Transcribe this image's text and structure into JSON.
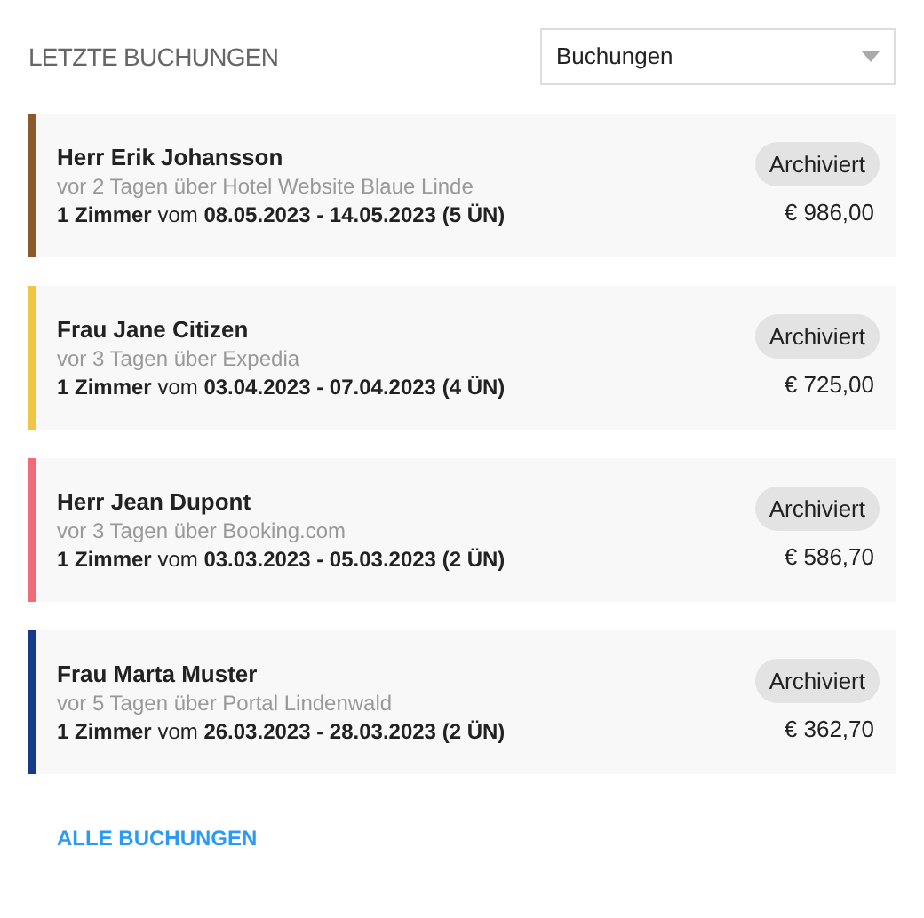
{
  "header": {
    "title": "LETZTE BUCHUNGEN",
    "filter": {
      "value": "Buchungen"
    }
  },
  "bookings": [
    {
      "guest": "Herr Erik Johansson",
      "source": "vor 2 Tagen über Hotel Website Blaue Linde",
      "details": "**1 Zimmer** vom **08.05.2023 - 14.05.2023 (5 ÜN)**",
      "status": "Archiviert",
      "price": "€ 986,00",
      "color": "#8b5a2b"
    },
    {
      "guest": "Frau Jane Citizen",
      "source": "vor 3 Tagen über Expedia",
      "details": "**1 Zimmer** vom **03.04.2023 - 07.04.2023 (4 ÜN)**",
      "status": "Archiviert",
      "price": "€ 725,00",
      "color": "#eec643"
    },
    {
      "guest": "Herr Jean Dupont",
      "source": "vor 3 Tagen über Booking.com",
      "details": "**1 Zimmer** vom **03.03.2023 - 05.03.2023 (2 ÜN)**",
      "status": "Archiviert",
      "price": "€ 586,70",
      "color": "#f06b78"
    },
    {
      "guest": "Frau Marta Muster",
      "source": "vor 5 Tagen über Portal Lindenwald",
      "details": "**1 Zimmer** vom **26.03.2023 - 28.03.2023 (2 ÜN)**",
      "status": "Archiviert",
      "price": "€ 362,70",
      "color": "#163a8a"
    }
  ],
  "footer_link": "ALLE BUCHUNGEN"
}
